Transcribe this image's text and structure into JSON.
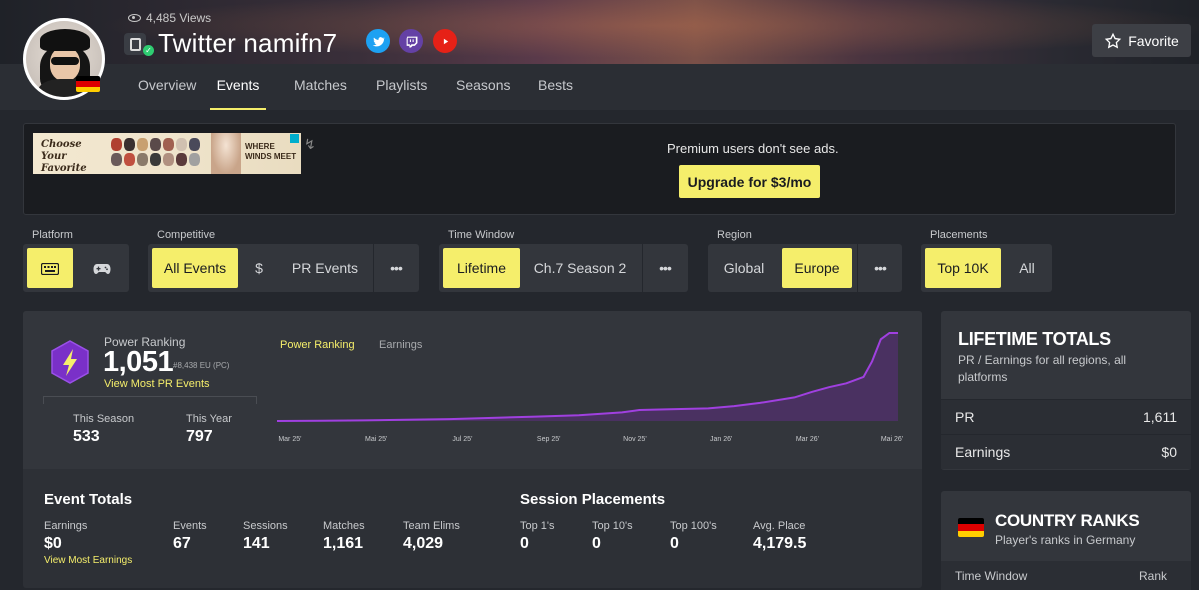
{
  "header": {
    "views": "4,485 Views",
    "player_name": "Twitter namifn7",
    "favorite_label": "Favorite"
  },
  "nav": {
    "tabs": [
      {
        "label": "Overview",
        "active": false
      },
      {
        "label": "Events",
        "active": true
      },
      {
        "label": "Matches",
        "active": false
      },
      {
        "label": "Playlists",
        "active": false
      },
      {
        "label": "Seasons",
        "active": false
      },
      {
        "label": "Bests",
        "active": false
      }
    ]
  },
  "ad": {
    "left_text": "Choose Your Favorite Mask",
    "right_text": "WHERE WINDS MEET",
    "premium_text": "Premium users don't see ads.",
    "upgrade_label": "Upgrade for $3/mo"
  },
  "filters": {
    "platform": {
      "label": "Platform"
    },
    "competitive": {
      "label": "Competitive",
      "options": [
        "All Events",
        "$",
        "PR Events",
        "•••"
      ]
    },
    "time_window": {
      "label": "Time Window",
      "options": [
        "Lifetime",
        "Ch.7 Season 2",
        "•••"
      ]
    },
    "region": {
      "label": "Region",
      "options": [
        "Global",
        "Europe",
        "•••"
      ]
    },
    "placements": {
      "label": "Placements",
      "options": [
        "Top 10K",
        "All"
      ]
    }
  },
  "power_ranking": {
    "label": "Power Ranking",
    "value": "1,051",
    "sub": "#8,438 EU (PC)",
    "link": "View Most PR Events",
    "this_season_label": "This Season",
    "this_season_value": "533",
    "this_year_label": "This Year",
    "this_year_value": "797"
  },
  "chart_data": {
    "type": "area",
    "tabs": [
      "Power Ranking",
      "Earnings"
    ],
    "active_tab": "Power Ranking",
    "x_ticks": [
      "Mar 25'",
      "Mai 25'",
      "Jul 25'",
      "Sep 25'",
      "Nov 25'",
      "Jan 26'",
      "Mar 26'",
      "Mai 26'"
    ],
    "x": [
      0,
      0.5,
      1,
      1.5,
      2,
      2.5,
      3,
      3.5,
      4,
      4.2,
      4.5,
      5,
      5.3,
      5.6,
      6,
      6.2,
      6.4,
      6.6,
      6.8,
      6.9,
      7,
      7.1,
      7.2
    ],
    "values": [
      0,
      2,
      4,
      8,
      12,
      20,
      28,
      36,
      55,
      70,
      74,
      80,
      95,
      115,
      150,
      185,
      215,
      240,
      280,
      380,
      520,
      560,
      560
    ],
    "line_color": "#a040e0",
    "fill_color": "#5a2e7a",
    "grid": false
  },
  "event_totals": {
    "title": "Event Totals",
    "items": [
      {
        "label": "Earnings",
        "value": "$0"
      },
      {
        "label": "Events",
        "value": "67"
      },
      {
        "label": "Sessions",
        "value": "141"
      },
      {
        "label": "Matches",
        "value": "1,161"
      },
      {
        "label": "Team Elims",
        "value": "4,029"
      }
    ],
    "link": "View Most Earnings"
  },
  "session_placements": {
    "title": "Session Placements",
    "items": [
      {
        "label": "Top 1's",
        "value": "0"
      },
      {
        "label": "Top 10's",
        "value": "0"
      },
      {
        "label": "Top 100's",
        "value": "0"
      },
      {
        "label": "Avg. Place",
        "value": "4,179.5"
      }
    ]
  },
  "lifetime_totals": {
    "title": "LIFETIME TOTALS",
    "subtitle": "PR / Earnings for all regions, all platforms",
    "rows": [
      {
        "label": "PR",
        "value": "1,611"
      },
      {
        "label": "Earnings",
        "value": "$0"
      }
    ]
  },
  "country_ranks": {
    "title": "COUNTRY RANKS",
    "subtitle": "Player's ranks in Germany",
    "col_left": "Time Window",
    "col_right": "Rank"
  },
  "colors": {
    "accent": "#f5ee6b",
    "bg": "#24272d",
    "panel": "#33363c",
    "purple": "#a040e0"
  }
}
